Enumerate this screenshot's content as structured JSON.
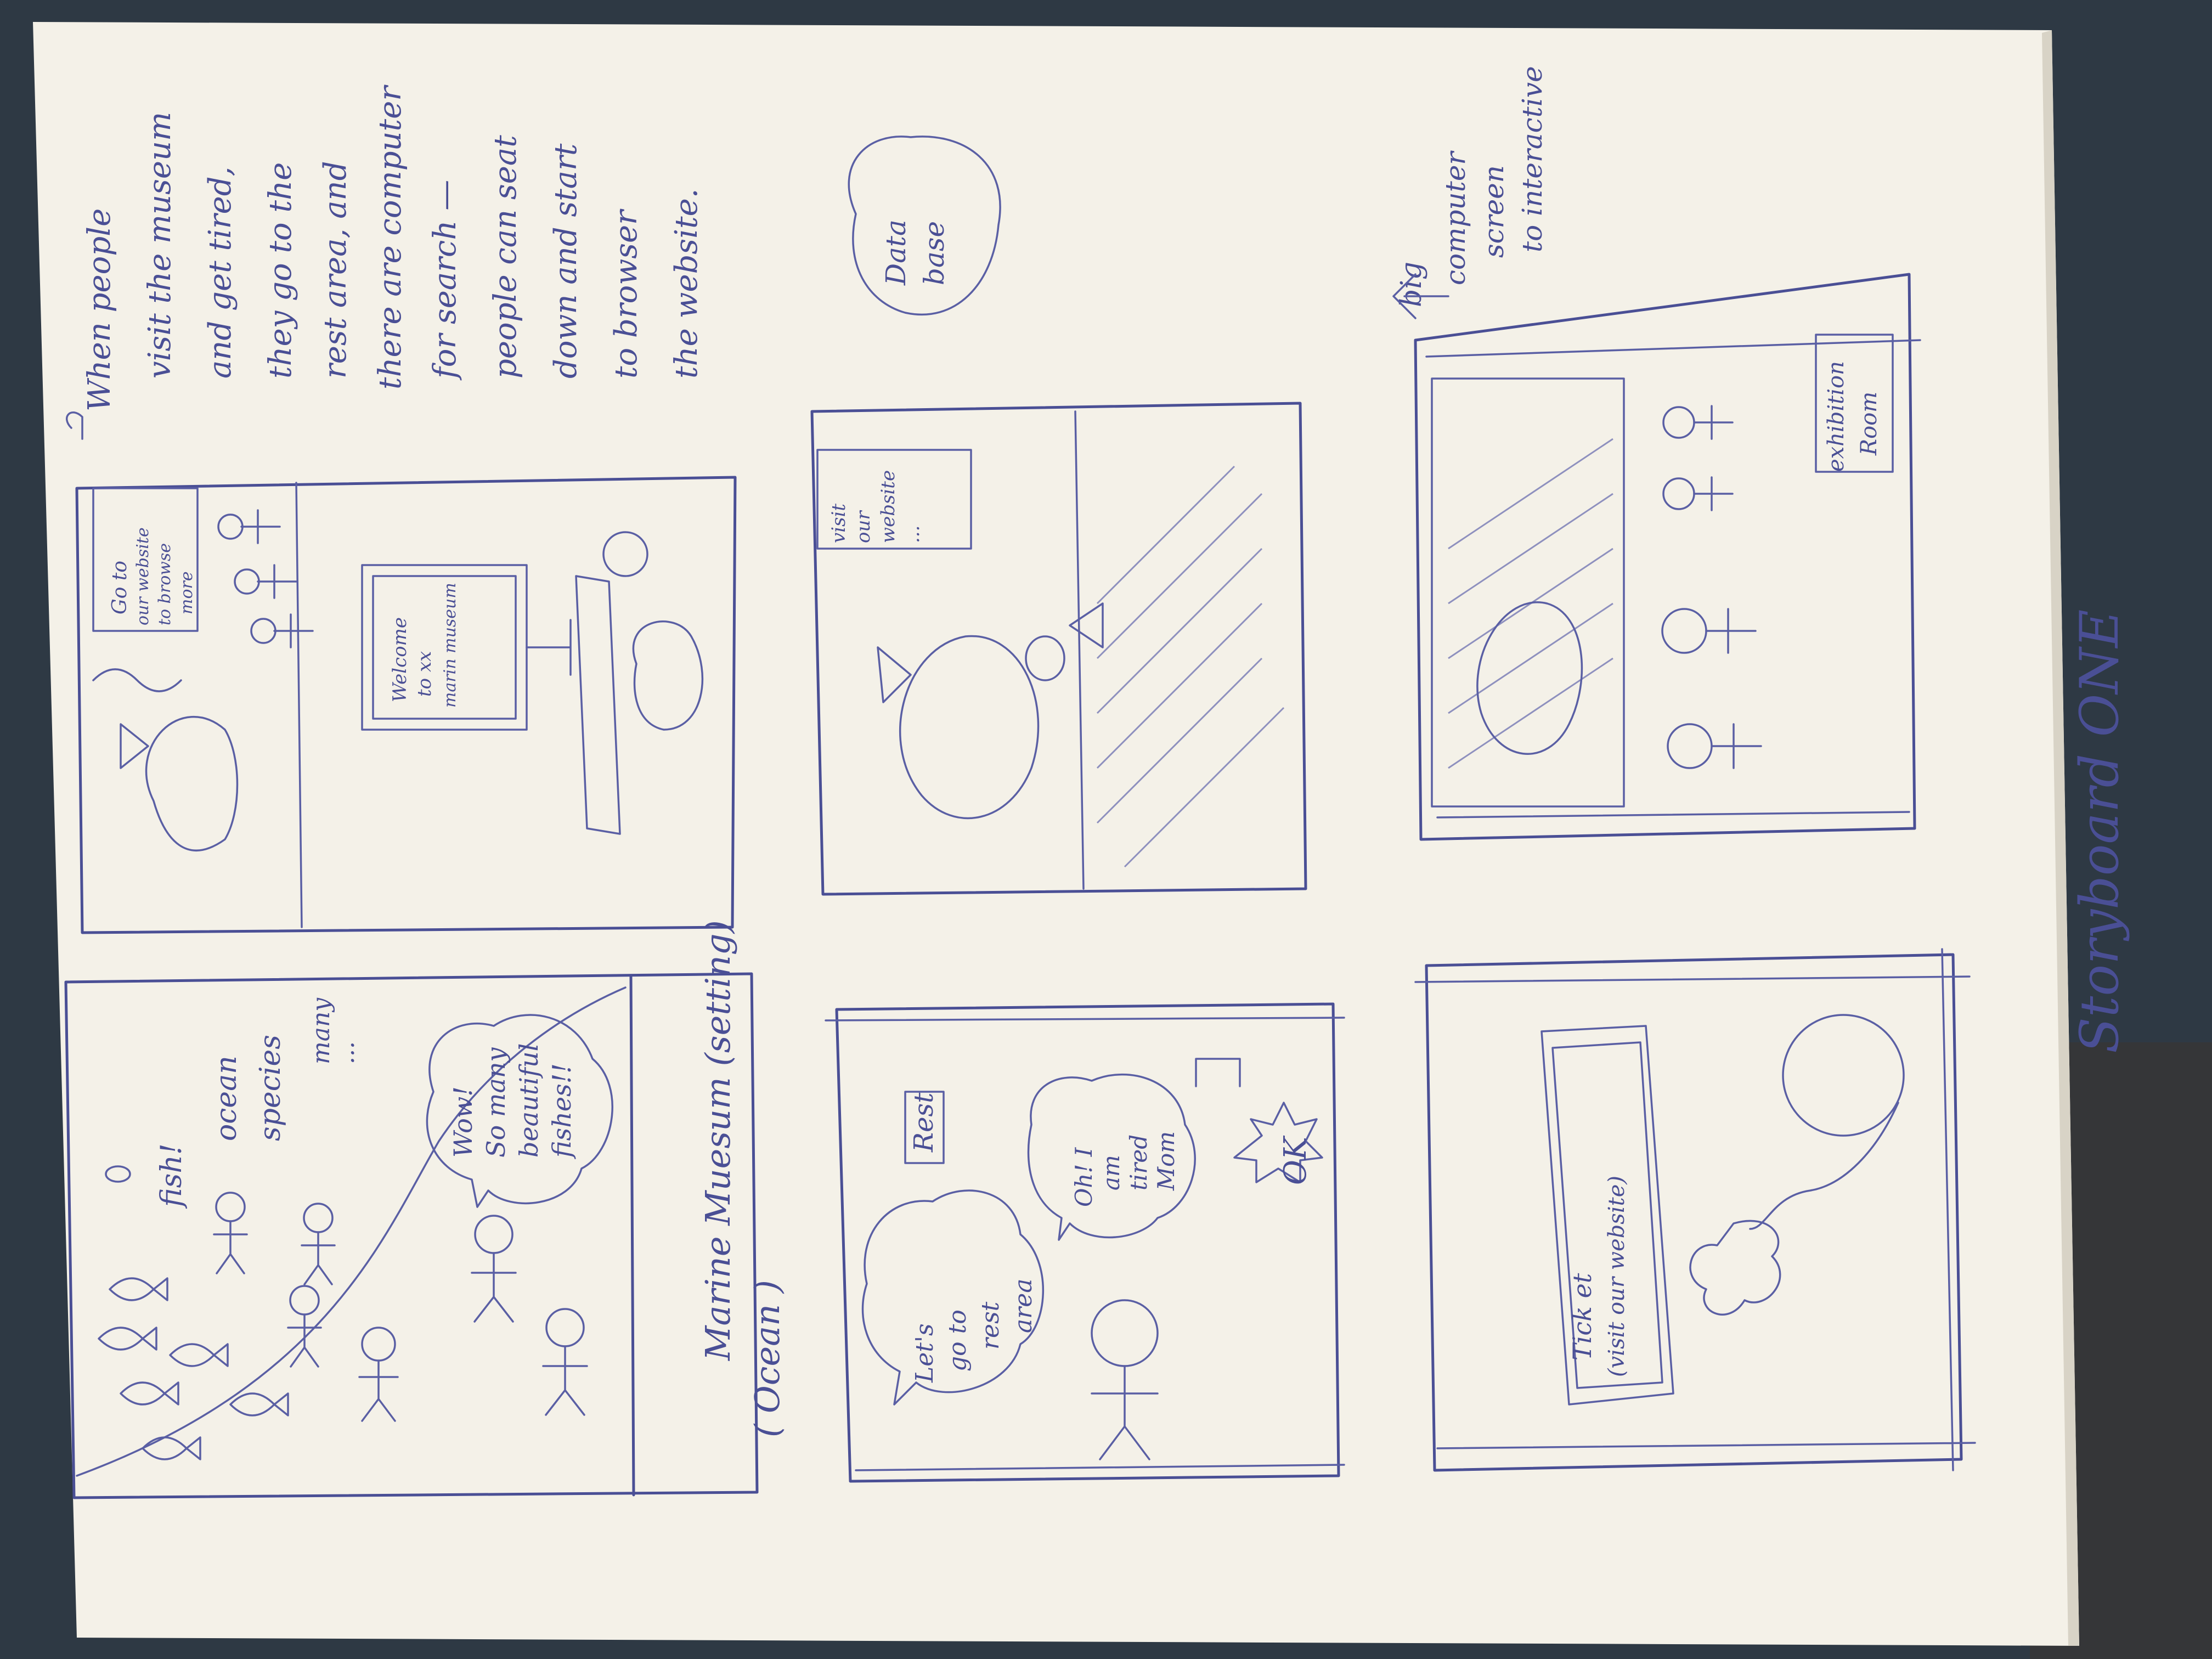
{
  "photo": {
    "description_free": true,
    "colors": {
      "background": "#2e3944",
      "paper": "#f4f1e8",
      "ink": "#4a4f95"
    }
  },
  "panels": {
    "p1": {
      "caption_main": "Marine Muesum (setting)",
      "caption_sub": "( Ocean )",
      "labels": [
        "fish!",
        "ocean",
        "species",
        "many",
        "..."
      ],
      "bubble": [
        "Wow!",
        "So many",
        "beautiful",
        "fishes!!"
      ]
    },
    "p2": {
      "bubble_left": [
        "Let's",
        "go to",
        "rest",
        "area"
      ],
      "bubble_mid": [
        "Oh! I",
        "am",
        "tired",
        "Mom"
      ],
      "sign": "Rest",
      "bubble_ok": "OK"
    },
    "p3": {
      "ticket": [
        "Tick et",
        "(visit our website)"
      ]
    },
    "p4": {
      "sign": [
        "Go to",
        "our website",
        "to browse",
        "more"
      ],
      "screen": [
        "Welcome",
        "to xx",
        "marin museum"
      ]
    },
    "p5": {
      "sign": [
        "visit",
        "our",
        "website",
        "..."
      ],
      "bubble": [
        "Data",
        "base"
      ]
    },
    "p6": {
      "sign": [
        "exhibition",
        "Room"
      ],
      "side_note": [
        "big",
        "computer",
        "screen",
        "to interactive"
      ]
    }
  },
  "notes": {
    "description": [
      "When people",
      "visit the museum",
      "and get tired,",
      "they go to the",
      "rest area, and",
      "there are computer",
      "for search —",
      "people can seat",
      "down and start",
      "to browser",
      "the website."
    ]
  },
  "title": "Storyboard ONE"
}
